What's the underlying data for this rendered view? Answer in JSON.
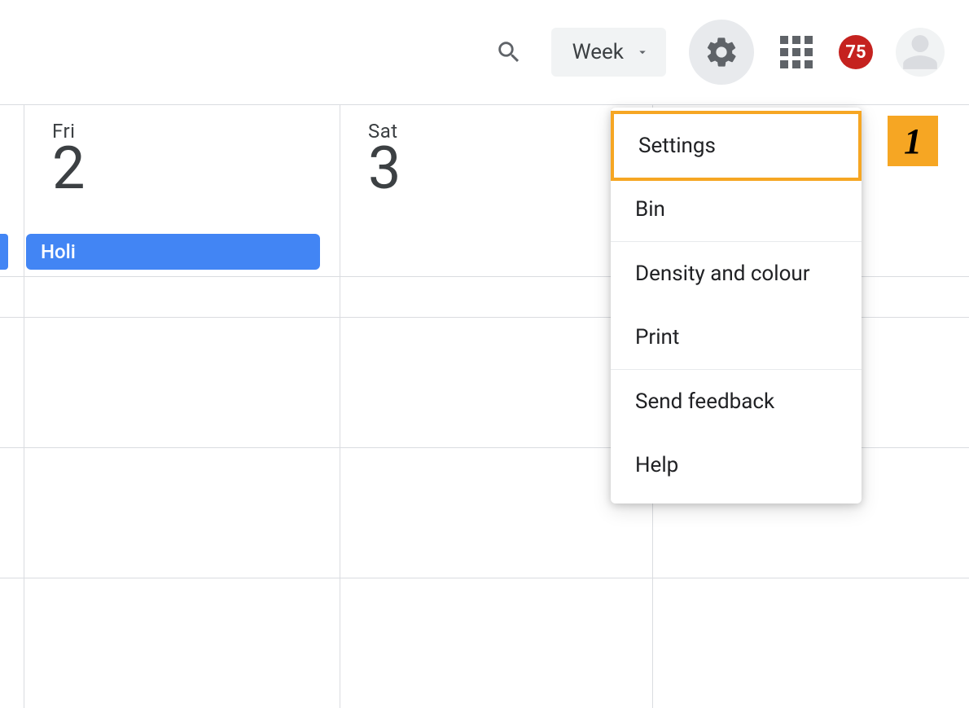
{
  "toolbar": {
    "view_label": "Week",
    "notification_count": "75"
  },
  "days": {
    "fri": {
      "name": "Fri",
      "num": "2",
      "event": "Holi"
    },
    "sat": {
      "name": "Sat",
      "num": "3"
    }
  },
  "menu": {
    "settings": "Settings",
    "bin": "Bin",
    "density": "Density and colour",
    "print": "Print",
    "feedback": "Send feedback",
    "help": "Help"
  },
  "annotation": {
    "step": "1"
  }
}
